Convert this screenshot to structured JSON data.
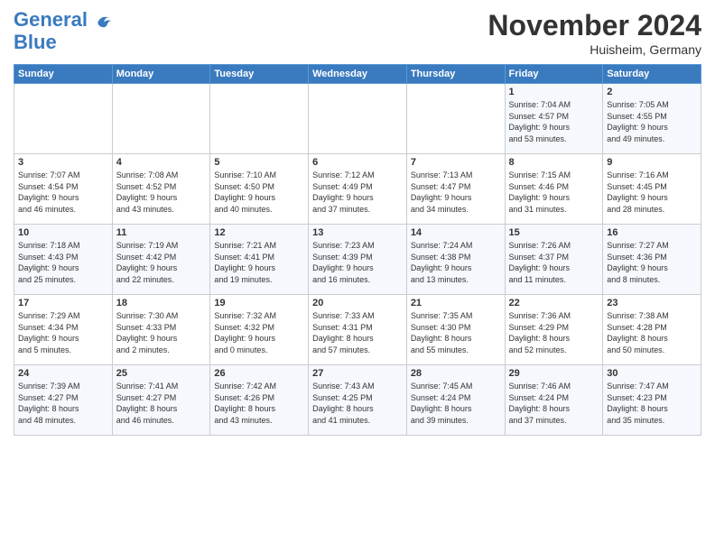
{
  "header": {
    "logo_line1": "General",
    "logo_line2": "Blue",
    "month_title": "November 2024",
    "location": "Huisheim, Germany"
  },
  "weekdays": [
    "Sunday",
    "Monday",
    "Tuesday",
    "Wednesday",
    "Thursday",
    "Friday",
    "Saturday"
  ],
  "weeks": [
    [
      {
        "day": "",
        "info": ""
      },
      {
        "day": "",
        "info": ""
      },
      {
        "day": "",
        "info": ""
      },
      {
        "day": "",
        "info": ""
      },
      {
        "day": "",
        "info": ""
      },
      {
        "day": "1",
        "info": "Sunrise: 7:04 AM\nSunset: 4:57 PM\nDaylight: 9 hours\nand 53 minutes."
      },
      {
        "day": "2",
        "info": "Sunrise: 7:05 AM\nSunset: 4:55 PM\nDaylight: 9 hours\nand 49 minutes."
      }
    ],
    [
      {
        "day": "3",
        "info": "Sunrise: 7:07 AM\nSunset: 4:54 PM\nDaylight: 9 hours\nand 46 minutes."
      },
      {
        "day": "4",
        "info": "Sunrise: 7:08 AM\nSunset: 4:52 PM\nDaylight: 9 hours\nand 43 minutes."
      },
      {
        "day": "5",
        "info": "Sunrise: 7:10 AM\nSunset: 4:50 PM\nDaylight: 9 hours\nand 40 minutes."
      },
      {
        "day": "6",
        "info": "Sunrise: 7:12 AM\nSunset: 4:49 PM\nDaylight: 9 hours\nand 37 minutes."
      },
      {
        "day": "7",
        "info": "Sunrise: 7:13 AM\nSunset: 4:47 PM\nDaylight: 9 hours\nand 34 minutes."
      },
      {
        "day": "8",
        "info": "Sunrise: 7:15 AM\nSunset: 4:46 PM\nDaylight: 9 hours\nand 31 minutes."
      },
      {
        "day": "9",
        "info": "Sunrise: 7:16 AM\nSunset: 4:45 PM\nDaylight: 9 hours\nand 28 minutes."
      }
    ],
    [
      {
        "day": "10",
        "info": "Sunrise: 7:18 AM\nSunset: 4:43 PM\nDaylight: 9 hours\nand 25 minutes."
      },
      {
        "day": "11",
        "info": "Sunrise: 7:19 AM\nSunset: 4:42 PM\nDaylight: 9 hours\nand 22 minutes."
      },
      {
        "day": "12",
        "info": "Sunrise: 7:21 AM\nSunset: 4:41 PM\nDaylight: 9 hours\nand 19 minutes."
      },
      {
        "day": "13",
        "info": "Sunrise: 7:23 AM\nSunset: 4:39 PM\nDaylight: 9 hours\nand 16 minutes."
      },
      {
        "day": "14",
        "info": "Sunrise: 7:24 AM\nSunset: 4:38 PM\nDaylight: 9 hours\nand 13 minutes."
      },
      {
        "day": "15",
        "info": "Sunrise: 7:26 AM\nSunset: 4:37 PM\nDaylight: 9 hours\nand 11 minutes."
      },
      {
        "day": "16",
        "info": "Sunrise: 7:27 AM\nSunset: 4:36 PM\nDaylight: 9 hours\nand 8 minutes."
      }
    ],
    [
      {
        "day": "17",
        "info": "Sunrise: 7:29 AM\nSunset: 4:34 PM\nDaylight: 9 hours\nand 5 minutes."
      },
      {
        "day": "18",
        "info": "Sunrise: 7:30 AM\nSunset: 4:33 PM\nDaylight: 9 hours\nand 2 minutes."
      },
      {
        "day": "19",
        "info": "Sunrise: 7:32 AM\nSunset: 4:32 PM\nDaylight: 9 hours\nand 0 minutes."
      },
      {
        "day": "20",
        "info": "Sunrise: 7:33 AM\nSunset: 4:31 PM\nDaylight: 8 hours\nand 57 minutes."
      },
      {
        "day": "21",
        "info": "Sunrise: 7:35 AM\nSunset: 4:30 PM\nDaylight: 8 hours\nand 55 minutes."
      },
      {
        "day": "22",
        "info": "Sunrise: 7:36 AM\nSunset: 4:29 PM\nDaylight: 8 hours\nand 52 minutes."
      },
      {
        "day": "23",
        "info": "Sunrise: 7:38 AM\nSunset: 4:28 PM\nDaylight: 8 hours\nand 50 minutes."
      }
    ],
    [
      {
        "day": "24",
        "info": "Sunrise: 7:39 AM\nSunset: 4:27 PM\nDaylight: 8 hours\nand 48 minutes."
      },
      {
        "day": "25",
        "info": "Sunrise: 7:41 AM\nSunset: 4:27 PM\nDaylight: 8 hours\nand 46 minutes."
      },
      {
        "day": "26",
        "info": "Sunrise: 7:42 AM\nSunset: 4:26 PM\nDaylight: 8 hours\nand 43 minutes."
      },
      {
        "day": "27",
        "info": "Sunrise: 7:43 AM\nSunset: 4:25 PM\nDaylight: 8 hours\nand 41 minutes."
      },
      {
        "day": "28",
        "info": "Sunrise: 7:45 AM\nSunset: 4:24 PM\nDaylight: 8 hours\nand 39 minutes."
      },
      {
        "day": "29",
        "info": "Sunrise: 7:46 AM\nSunset: 4:24 PM\nDaylight: 8 hours\nand 37 minutes."
      },
      {
        "day": "30",
        "info": "Sunrise: 7:47 AM\nSunset: 4:23 PM\nDaylight: 8 hours\nand 35 minutes."
      }
    ]
  ]
}
